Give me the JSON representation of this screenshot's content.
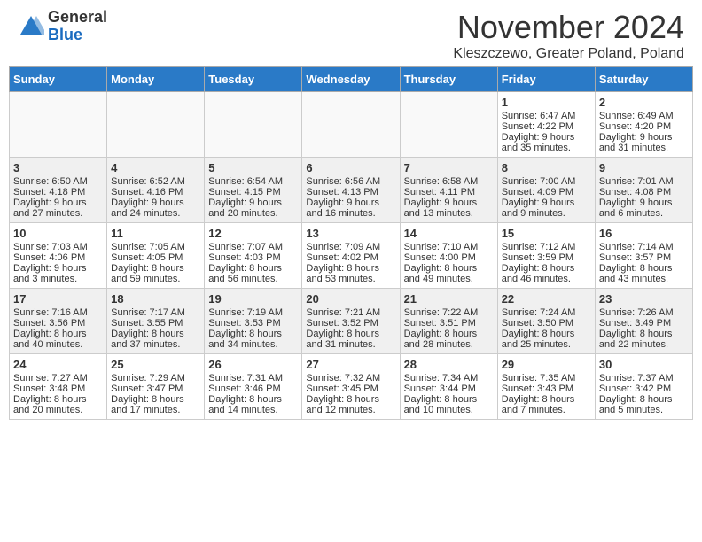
{
  "header": {
    "logo_general": "General",
    "logo_blue": "Blue",
    "title": "November 2024",
    "location": "Kleszczewo, Greater Poland, Poland"
  },
  "days_of_week": [
    "Sunday",
    "Monday",
    "Tuesday",
    "Wednesday",
    "Thursday",
    "Friday",
    "Saturday"
  ],
  "weeks": [
    [
      {
        "day": "",
        "info": ""
      },
      {
        "day": "",
        "info": ""
      },
      {
        "day": "",
        "info": ""
      },
      {
        "day": "",
        "info": ""
      },
      {
        "day": "",
        "info": ""
      },
      {
        "day": "1",
        "info": "Sunrise: 6:47 AM\nSunset: 4:22 PM\nDaylight: 9 hours and 35 minutes."
      },
      {
        "day": "2",
        "info": "Sunrise: 6:49 AM\nSunset: 4:20 PM\nDaylight: 9 hours and 31 minutes."
      }
    ],
    [
      {
        "day": "3",
        "info": "Sunrise: 6:50 AM\nSunset: 4:18 PM\nDaylight: 9 hours and 27 minutes."
      },
      {
        "day": "4",
        "info": "Sunrise: 6:52 AM\nSunset: 4:16 PM\nDaylight: 9 hours and 24 minutes."
      },
      {
        "day": "5",
        "info": "Sunrise: 6:54 AM\nSunset: 4:15 PM\nDaylight: 9 hours and 20 minutes."
      },
      {
        "day": "6",
        "info": "Sunrise: 6:56 AM\nSunset: 4:13 PM\nDaylight: 9 hours and 16 minutes."
      },
      {
        "day": "7",
        "info": "Sunrise: 6:58 AM\nSunset: 4:11 PM\nDaylight: 9 hours and 13 minutes."
      },
      {
        "day": "8",
        "info": "Sunrise: 7:00 AM\nSunset: 4:09 PM\nDaylight: 9 hours and 9 minutes."
      },
      {
        "day": "9",
        "info": "Sunrise: 7:01 AM\nSunset: 4:08 PM\nDaylight: 9 hours and 6 minutes."
      }
    ],
    [
      {
        "day": "10",
        "info": "Sunrise: 7:03 AM\nSunset: 4:06 PM\nDaylight: 9 hours and 3 minutes."
      },
      {
        "day": "11",
        "info": "Sunrise: 7:05 AM\nSunset: 4:05 PM\nDaylight: 8 hours and 59 minutes."
      },
      {
        "day": "12",
        "info": "Sunrise: 7:07 AM\nSunset: 4:03 PM\nDaylight: 8 hours and 56 minutes."
      },
      {
        "day": "13",
        "info": "Sunrise: 7:09 AM\nSunset: 4:02 PM\nDaylight: 8 hours and 53 minutes."
      },
      {
        "day": "14",
        "info": "Sunrise: 7:10 AM\nSunset: 4:00 PM\nDaylight: 8 hours and 49 minutes."
      },
      {
        "day": "15",
        "info": "Sunrise: 7:12 AM\nSunset: 3:59 PM\nDaylight: 8 hours and 46 minutes."
      },
      {
        "day": "16",
        "info": "Sunrise: 7:14 AM\nSunset: 3:57 PM\nDaylight: 8 hours and 43 minutes."
      }
    ],
    [
      {
        "day": "17",
        "info": "Sunrise: 7:16 AM\nSunset: 3:56 PM\nDaylight: 8 hours and 40 minutes."
      },
      {
        "day": "18",
        "info": "Sunrise: 7:17 AM\nSunset: 3:55 PM\nDaylight: 8 hours and 37 minutes."
      },
      {
        "day": "19",
        "info": "Sunrise: 7:19 AM\nSunset: 3:53 PM\nDaylight: 8 hours and 34 minutes."
      },
      {
        "day": "20",
        "info": "Sunrise: 7:21 AM\nSunset: 3:52 PM\nDaylight: 8 hours and 31 minutes."
      },
      {
        "day": "21",
        "info": "Sunrise: 7:22 AM\nSunset: 3:51 PM\nDaylight: 8 hours and 28 minutes."
      },
      {
        "day": "22",
        "info": "Sunrise: 7:24 AM\nSunset: 3:50 PM\nDaylight: 8 hours and 25 minutes."
      },
      {
        "day": "23",
        "info": "Sunrise: 7:26 AM\nSunset: 3:49 PM\nDaylight: 8 hours and 22 minutes."
      }
    ],
    [
      {
        "day": "24",
        "info": "Sunrise: 7:27 AM\nSunset: 3:48 PM\nDaylight: 8 hours and 20 minutes."
      },
      {
        "day": "25",
        "info": "Sunrise: 7:29 AM\nSunset: 3:47 PM\nDaylight: 8 hours and 17 minutes."
      },
      {
        "day": "26",
        "info": "Sunrise: 7:31 AM\nSunset: 3:46 PM\nDaylight: 8 hours and 14 minutes."
      },
      {
        "day": "27",
        "info": "Sunrise: 7:32 AM\nSunset: 3:45 PM\nDaylight: 8 hours and 12 minutes."
      },
      {
        "day": "28",
        "info": "Sunrise: 7:34 AM\nSunset: 3:44 PM\nDaylight: 8 hours and 10 minutes."
      },
      {
        "day": "29",
        "info": "Sunrise: 7:35 AM\nSunset: 3:43 PM\nDaylight: 8 hours and 7 minutes."
      },
      {
        "day": "30",
        "info": "Sunrise: 7:37 AM\nSunset: 3:42 PM\nDaylight: 8 hours and 5 minutes."
      }
    ]
  ]
}
